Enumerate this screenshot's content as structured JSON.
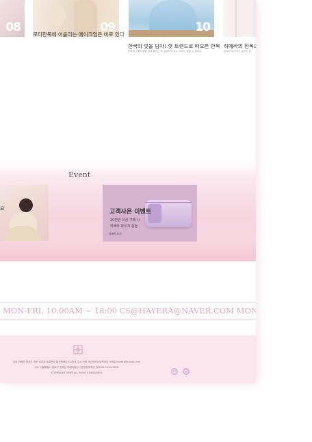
{
  "thumbs": [
    {
      "num": "08",
      "name": "thumb-08"
    },
    {
      "num": "09",
      "name": "thumb-09"
    },
    {
      "num": "10",
      "name": "thumb-10"
    },
    {
      "num": "",
      "name": "thumb-11"
    }
  ],
  "captions": {
    "c09": "로티한복에 어울리는 메이크업은 바로 있다",
    "c10": "한국의 멋을 담아! 핫 트렌드로 떠오른 한복",
    "c10_sub": "한복의 아름다움을 담게 알리는 대 설정하고 있는 브랜드 입을 수 헤라요.",
    "c11": "하에라의 한복과",
    "c11_sub": "하에라 헤이어스 알려진 한"
  },
  "event": {
    "title": "Event",
    "card1_text": "요",
    "card2_title": "고객사은 이벤트",
    "card2_line1": "20만원 이상 구매 시",
    "card2_line2": "하에라 파우치 증정",
    "card2_more": "자세히 보기"
  },
  "ticker": {
    "text": "MON-FRI, 10:00AM ~ 18:00  CS@HAYERA@NAVER.COM   MON-FRI, 1"
  },
  "footer": {
    "line1": "상호 하에라 대표자 최문 사업자 등록번호 통신판매업신고번호 주소 전화 개인정보보호책임자 이메일 hayera@naver.com",
    "line2": "주소 서울특별시 종로구 한복길 하에라빌딩 사업자정보확인 전화 02-1234-5678",
    "line3": "COPYRIGHT 하에라 ALL RIGHTS RESERVED"
  },
  "colors": {
    "accent": "#e4a5bf",
    "footer_bg": "#fbe6ee",
    "event_card": "#d6b4cf"
  }
}
